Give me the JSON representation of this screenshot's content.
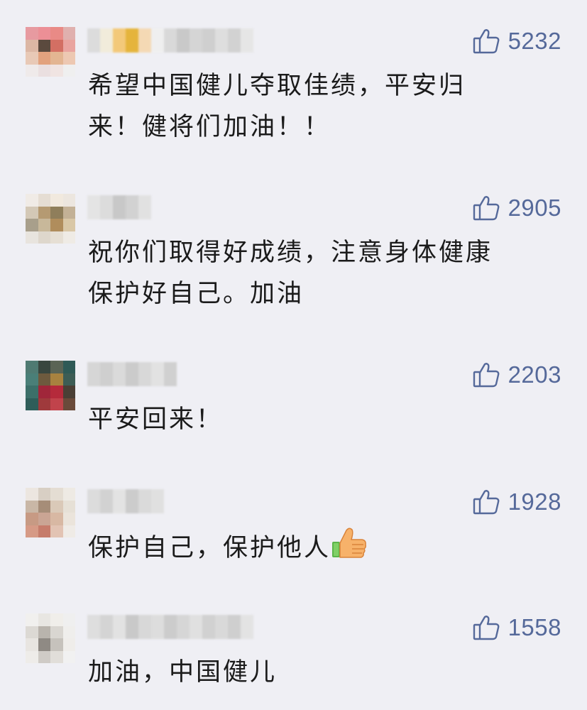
{
  "comments": [
    {
      "likes": "5232",
      "text_lines": [
        "希望中国健儿夺取佳绩，平安归",
        "来！健将们加油！！"
      ],
      "emoji": "",
      "avatar_colors": [
        "#e79aa0",
        "#ec8f96",
        "#e98a86",
        "#e0b0ae",
        "#dcb7a4",
        "#5b4a3e",
        "#d36f63",
        "#e9a49f",
        "#e8c9b6",
        "#e2a27e",
        "#e3b592",
        "#edc8b2",
        "#efeaea",
        "#eadfe0",
        "#f0e4e2",
        "#efefef"
      ],
      "name_colors": [
        "#dcdcdc",
        "#f1ecdb",
        "#f3c97a",
        "#e5b43c",
        "#f4d9b4",
        "#efefef",
        "#d9d9d9",
        "#c9c9c9",
        "#d5d5d5",
        "#cfcfcf",
        "#dedede",
        "#d2d2d2",
        "#e6e6e6"
      ]
    },
    {
      "likes": "2905",
      "text_lines": [
        "祝你们取得好成绩，注意身体健康",
        "保护好自己。加油"
      ],
      "emoji": "",
      "avatar_colors": [
        "#f0ebe6",
        "#e5ddd3",
        "#f1e9de",
        "#ece6df",
        "#d3c8b6",
        "#b59a72",
        "#8f7e5b",
        "#c3b196",
        "#a89f8b",
        "#c8b89a",
        "#b08d5c",
        "#d9c7a6",
        "#e8e4de",
        "#ded7cc",
        "#e6dfd4",
        "#efebe5"
      ],
      "name_colors": [
        "#e4e4e4",
        "#dcdcdc",
        "#c8c8c8",
        "#d2d2d2",
        "#e1e1e1"
      ]
    },
    {
      "likes": "2203",
      "text_lines": [
        "平安回来！"
      ],
      "emoji": "",
      "avatar_colors": [
        "#4f7a72",
        "#39463f",
        "#5a6455",
        "#2f5a56",
        "#4a7f78",
        "#6e5a3e",
        "#a8823f",
        "#3d5d55",
        "#3c6f69",
        "#a0263a",
        "#b52a3b",
        "#4a3f35",
        "#2f5d59",
        "#9f3a3c",
        "#c1434b",
        "#6a4a3a"
      ],
      "name_colors": [
        "#d6d6d6",
        "#cfcfcf",
        "#dadada",
        "#cbcbcb",
        "#d8d8d8",
        "#e2e2e2",
        "#d0d0d0"
      ]
    },
    {
      "likes": "1928",
      "text_lines": [
        "保护自己，保护他人"
      ],
      "emoji": "thumbs-up",
      "avatar_colors": [
        "#ece6e0",
        "#d8cfc4",
        "#e4ddd3",
        "#eeeae4",
        "#c9b7a6",
        "#a68d78",
        "#dac9b8",
        "#e6e0d6",
        "#c79a84",
        "#caa594",
        "#d8b8a3",
        "#ebe4db",
        "#d69a86",
        "#c67c6b",
        "#e2c3b3",
        "#efebe6"
      ],
      "name_colors": [
        "#dcdcdc",
        "#d2d2d2",
        "#e3e3e3",
        "#cccccc",
        "#dadada",
        "#e0e0e0"
      ]
    },
    {
      "likes": "1558",
      "text_lines": [
        "加油，中国健儿"
      ],
      "emoji": "",
      "avatar_colors": [
        "#f1f0ee",
        "#e8e6e2",
        "#f0eeea",
        "#efefef",
        "#dcd9d4",
        "#b9b4ad",
        "#d9d6d1",
        "#efeeec",
        "#e8e5e1",
        "#8f8a84",
        "#c6c2bc",
        "#efedea",
        "#eeece9",
        "#cfcbc6",
        "#e1ded9",
        "#f1f1f1"
      ],
      "name_colors": [
        "#dedede",
        "#d4d4d4",
        "#e2e2e2",
        "#c9c9c9",
        "#d8d8d8",
        "#dddddd",
        "#cccccc",
        "#d6d6d6",
        "#e0e0e0",
        "#d1d1d1",
        "#d9d9d9",
        "#cfcfcf",
        "#e3e3e3"
      ]
    }
  ]
}
